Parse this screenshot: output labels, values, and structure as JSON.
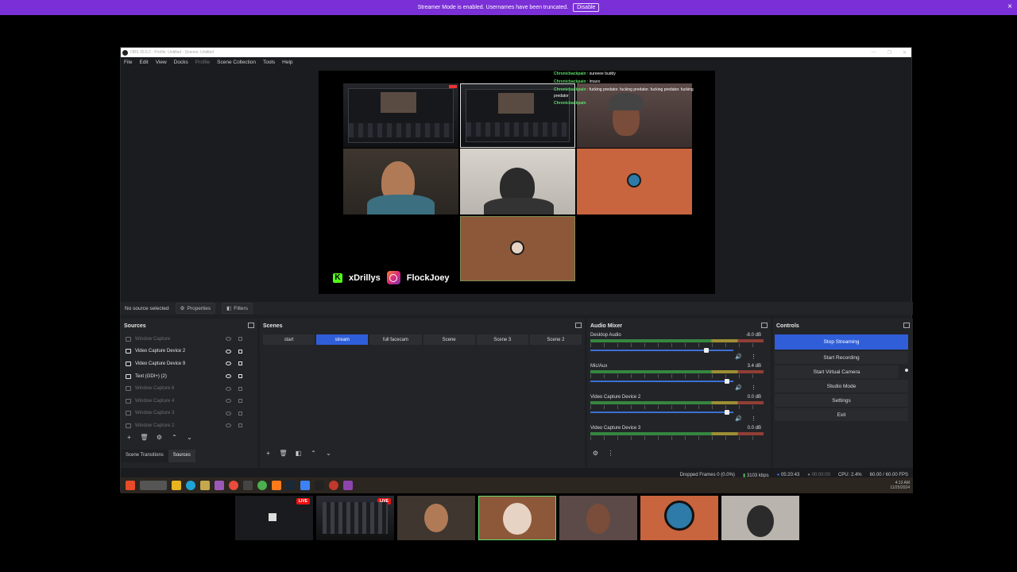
{
  "banner": {
    "text": "Streamer Mode is enabled. Usernames have been truncated.",
    "button": "Disable",
    "close": "×"
  },
  "window": {
    "title": "OBS 30.0.2 - Profile: Untitled - Scenes: Untitled",
    "controls": [
      "—",
      "❐",
      "✕"
    ]
  },
  "menu": {
    "items": [
      "File",
      "Edit",
      "View",
      "Docks",
      "Profile",
      "Scene Collection",
      "Tools",
      "Help"
    ]
  },
  "preview": {
    "chat": [
      {
        "user": "Chronicbackpain",
        "msg": ": sureeee buddy"
      },
      {
        "user": "Chronicbackpain",
        "msg": ": lmaoo"
      },
      {
        "user": "Chronicbackpain",
        "msg": ": fucking predator. fucking predator. fucking predator. fucking"
      },
      {
        "user": "",
        "msg": "predator"
      },
      {
        "user": "Chronicbackpain",
        "msg": ""
      }
    ],
    "kick_handle": "xDrillys",
    "instagram_handle": "FlockJoey"
  },
  "props": {
    "status": "No source selected",
    "properties": "Properties",
    "filters": "Filters"
  },
  "sources": {
    "title": "Sources",
    "items": [
      {
        "label": "Window Capture",
        "visible": false
      },
      {
        "label": "Video Capture Device 2",
        "visible": true
      },
      {
        "label": "Video Capture Device 9",
        "visible": true
      },
      {
        "label": "Text (GDI+) (2)",
        "visible": true
      },
      {
        "label": "Window Capture 6",
        "visible": false
      },
      {
        "label": "Window Capture 4",
        "visible": false
      },
      {
        "label": "Window Capture 3",
        "visible": false
      },
      {
        "label": "Window Capture 2",
        "visible": false
      }
    ],
    "tabs": [
      "Scene Transitions",
      "Sources"
    ]
  },
  "scenes": {
    "title": "Scenes",
    "items": [
      "start",
      "stream",
      "full facecam",
      "Scene",
      "Scene 3",
      "Scene 2"
    ],
    "active": "stream"
  },
  "mixer": {
    "title": "Audio Mixer",
    "channels": [
      {
        "name": "Desktop Audio",
        "db": "-8.0 dB",
        "fader": 0.82
      },
      {
        "name": "Mic/Aux",
        "db": "3.4 dB",
        "fader": 0.97
      },
      {
        "name": "Video Capture Device 2",
        "db": "0.0 dB",
        "fader": 0.97
      },
      {
        "name": "Video Capture Device 3",
        "db": "0.0 dB",
        "fader": 0.97
      }
    ]
  },
  "controls": {
    "title": "Controls",
    "buttons": [
      "Stop Streaming",
      "Start Recording",
      "Start Virtual Camera",
      "Studio Mode",
      "Settings",
      "Exit"
    ]
  },
  "status": {
    "dropped": "Dropped Frames 0 (0.0%)",
    "bitrate": "3103 kbps",
    "stream_time": "05:20:43",
    "rec_time": "00:00:00",
    "cpu": "CPU: 2.4%",
    "fps": "60.00 / 60.00 FPS"
  },
  "clock": {
    "time": "4:13 AM",
    "date": "11/25/2024"
  },
  "thumbnails": {
    "live": "LIVE"
  }
}
